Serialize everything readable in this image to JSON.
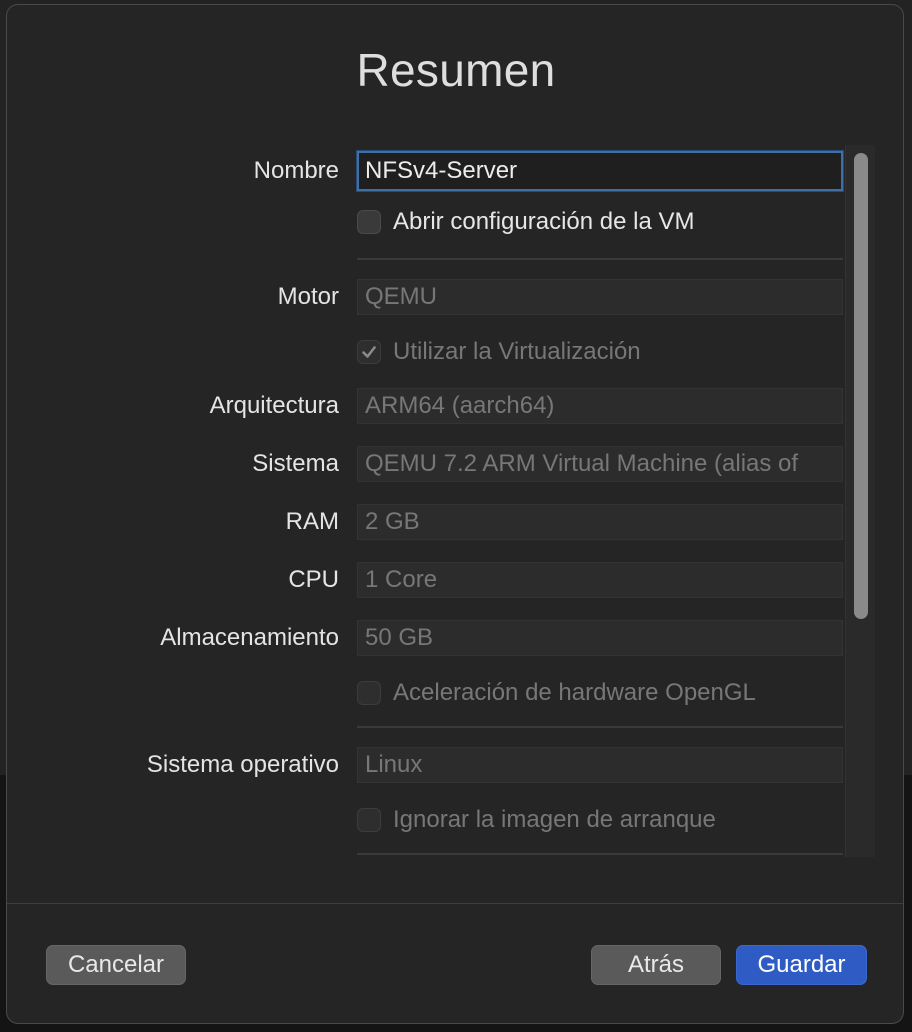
{
  "dialog": {
    "title": "Resumen"
  },
  "form": {
    "name": {
      "label": "Nombre",
      "value": "NFSv4-Server"
    },
    "open_vm_settings": {
      "label": "Abrir configuración de la VM",
      "checked": false
    },
    "engine": {
      "label": "Motor",
      "value": "QEMU"
    },
    "use_virtualization": {
      "label": "Utilizar la Virtualización",
      "checked": true
    },
    "architecture": {
      "label": "Arquitectura",
      "value": "ARM64 (aarch64)"
    },
    "system": {
      "label": "Sistema",
      "value": "QEMU 7.2 ARM Virtual Machine (alias of"
    },
    "ram": {
      "label": "RAM",
      "value": "2 GB"
    },
    "cpu": {
      "label": "CPU",
      "value": "1 Core"
    },
    "storage": {
      "label": "Almacenamiento",
      "value": "50 GB"
    },
    "opengl": {
      "label": "Aceleración de hardware OpenGL",
      "checked": false
    },
    "os": {
      "label": "Sistema operativo",
      "value": "Linux"
    },
    "skip_boot_image": {
      "label": "Ignorar la imagen de arranque",
      "checked": false
    }
  },
  "footer": {
    "cancel_label": "Cancelar",
    "back_label": "Atrás",
    "save_label": "Guardar"
  },
  "colors": {
    "accent": "#2f5cc4",
    "focus_ring": "#3d6fa8"
  }
}
